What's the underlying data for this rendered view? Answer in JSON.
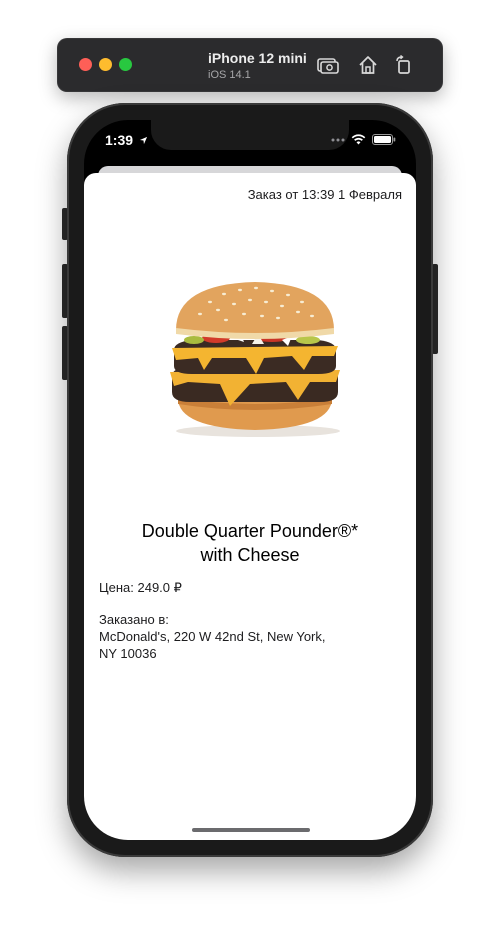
{
  "simulator": {
    "device_name": "iPhone 12 mini",
    "os_version": "iOS 14.1",
    "buttons": [
      "screenshot-icon",
      "home-icon",
      "rotate-icon"
    ],
    "traffic_colors": {
      "close": "#fe5f57",
      "minimize": "#febc2e",
      "zoom": "#28c840"
    }
  },
  "status_bar": {
    "time": "1:39",
    "icons": [
      "location-arrow-icon",
      "signal-dots-icon",
      "wifi-icon",
      "battery-icon"
    ]
  },
  "order": {
    "date_text": "Заказ от 13:39 1 Февраля",
    "product_image": "burger-image",
    "title_line1": "Double Quarter Pounder®*",
    "title_line2": "with Cheese",
    "price_text": "Цена: 249.0 ₽",
    "ordered_label": "Заказано в:",
    "address_line1": "McDonald's, 220 W 42nd St, New York,",
    "address_line2": "NY 10036"
  }
}
